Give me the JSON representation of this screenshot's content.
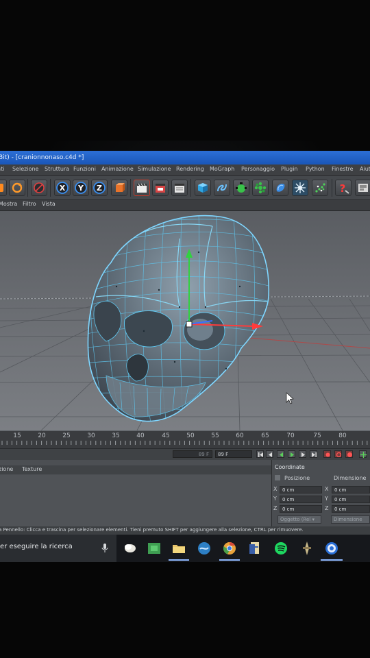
{
  "window": {
    "title": "Bit) - [cranionnonaso.c4d *]"
  },
  "menu": {
    "items": [
      "nti",
      "Selezione",
      "Struttura",
      "Funzioni",
      "Animazione",
      "Simulazione",
      "Rendering",
      "MoGraph",
      "Personaggio",
      "Plugin",
      "Python",
      "Finestre",
      "Aiut"
    ]
  },
  "toolbar": {
    "buttons": [
      "record-icon",
      "rotate-icon",
      "no-icon",
      "x-axis-icon",
      "y-axis-icon",
      "z-axis-icon",
      "coord-system-icon",
      "render-view-icon",
      "render-icon",
      "render-settings-icon",
      "cube-icon",
      "spline-icon",
      "nurbs-icon",
      "array-icon",
      "deformer-icon",
      "light-icon",
      "particle-icon",
      "help-icon",
      "layout-icon"
    ],
    "axis_labels": {
      "x": "X",
      "y": "Y",
      "z": "Z"
    }
  },
  "viewport": {
    "menu": [
      "Mostra",
      "Filtro",
      "Vista"
    ],
    "model": "skull-mesh",
    "colors": {
      "mesh": "#5fc6ee",
      "axis_y": "#31d23f",
      "axis_x": "#ff3b3b"
    }
  },
  "timeline": {
    "ticks": [
      "15",
      "20",
      "25",
      "30",
      "35",
      "40",
      "45",
      "50",
      "55",
      "60",
      "65",
      "70",
      "75",
      "80"
    ],
    "current_frame": "89 F",
    "end_frame": "89 F"
  },
  "bottom_panel": {
    "tabs": [
      "zione",
      "Texture"
    ]
  },
  "coords": {
    "title": "Coordinate",
    "col_position": "Posizione",
    "col_dimension": "Dimensione",
    "rows": [
      {
        "axis": "X",
        "pos": "0 cm",
        "axis2": "X",
        "dim": "0 cm"
      },
      {
        "axis": "Y",
        "pos": "0 cm",
        "axis2": "Y",
        "dim": "0 cm"
      },
      {
        "axis": "Z",
        "pos": "0 cm",
        "axis2": "Z",
        "dim": "0 cm"
      }
    ],
    "mode": "Oggetto (Rel ▾",
    "apply": "Dimensione"
  },
  "status": {
    "text": "a Pennello: Clicca e trascina per selezionare elementi. Tieni premuto SHIFT per aggiungere alla selezione, CTRL per rimuovere."
  },
  "taskbar": {
    "search_placeholder": "er eseguire la ricerca",
    "apps": [
      "mic-icon",
      "task-view-icon",
      "store-icon",
      "file-explorer-icon",
      "photoshop-icon",
      "chrome-icon",
      "c4d-doc-icon",
      "spotify-icon",
      "game-icon",
      "c4d-app-icon"
    ]
  }
}
